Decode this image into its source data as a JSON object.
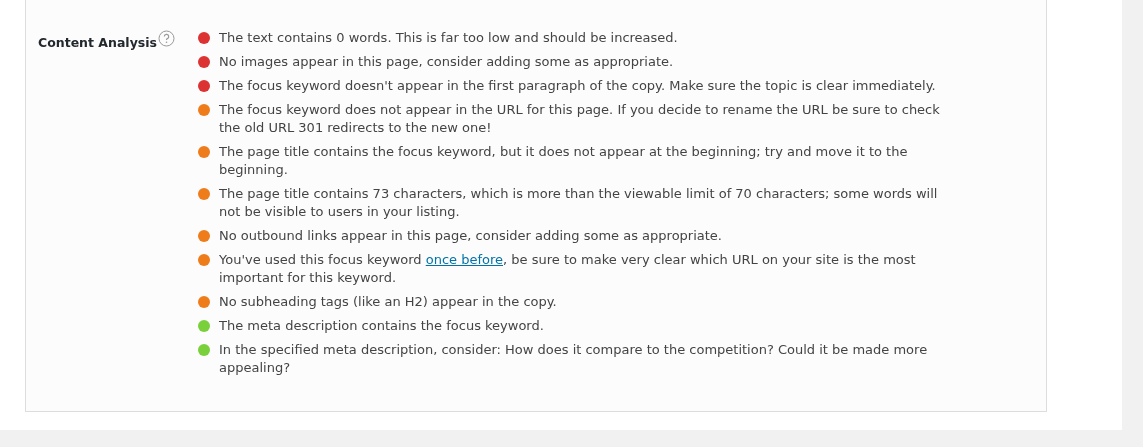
{
  "section": {
    "label": "Content Analysis",
    "items": [
      {
        "color": "#dc3232",
        "text": "The text contains 0 words. This is far too low and should be increased."
      },
      {
        "color": "#dc3232",
        "text": "No images appear in this page, consider adding some as appropriate."
      },
      {
        "color": "#dc3232",
        "text": "The focus keyword doesn't appear in the first paragraph of the copy. Make sure the topic is clear immediately."
      },
      {
        "color": "#ee7c1b",
        "text": "The focus keyword does not appear in the URL for this page. If you decide to rename the URL be sure to check the old URL 301 redirects to the new one!"
      },
      {
        "color": "#ee7c1b",
        "text": "The page title contains the focus keyword, but it does not appear at the beginning; try and move it to the beginning."
      },
      {
        "color": "#ee7c1b",
        "text": "The page title contains 73 characters, which is more than the viewable limit of 70 characters; some words will not be visible to users in your listing."
      },
      {
        "color": "#ee7c1b",
        "text": "No outbound links appear in this page, consider adding some as appropriate."
      },
      {
        "color": "#ee7c1b",
        "text": "You've used this focus keyword",
        "link": "once before",
        "text_after": ", be sure to make very clear which URL on your site is the most important for this keyword."
      },
      {
        "color": "#ee7c1b",
        "text": "No subheading tags (like an H2) appear in the copy."
      },
      {
        "color": "#7ad03a",
        "text": "The meta description contains the focus keyword."
      },
      {
        "color": "#7ad03a",
        "text": "In the specified meta description, consider: How does it compare to the competition? Could it be made more appealing?"
      }
    ]
  }
}
